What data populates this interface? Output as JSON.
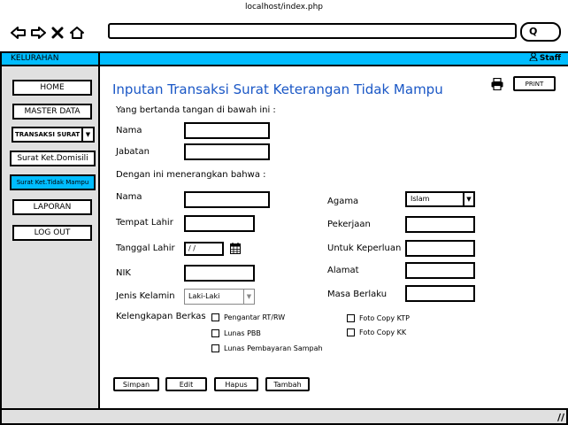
{
  "browser": {
    "address": "localhost/index.php",
    "search_icon_label": "Q"
  },
  "app": {
    "brand": "KELURAHAN",
    "user": "Staff"
  },
  "sidebar": {
    "items": [
      {
        "label": "HOME"
      },
      {
        "label": "MASTER DATA"
      },
      {
        "label": "TRANSAKSI SURAT"
      },
      {
        "label": "Surat Ket.Domisili"
      },
      {
        "label": "Surat Ket.Tidak Mampu",
        "active": true
      },
      {
        "label": "LAPORAN"
      },
      {
        "label": "LOG OUT"
      }
    ]
  },
  "main": {
    "title": "Inputan Transaksi Surat Keterangan Tidak Mampu",
    "print_label": "PRINT",
    "intro": "Yang bertanda tangan di bawah ini :",
    "signer": {
      "name_label": "Nama",
      "position_label": "Jabatan"
    },
    "section2": "Dengan ini menerangkan bahwa :",
    "left_fields": {
      "name_label": "Nama",
      "birthplace_label": "Tempat Lahir",
      "birthdate_label": "Tanggal Lahir",
      "birthdate_placeholder": "/ /",
      "nik_label": "NIK",
      "gender_label": "Jenis Kelamin",
      "gender_value": "Laki-Laki"
    },
    "right_fields": {
      "religion_label": "Agama",
      "religion_value": "Islam",
      "job_label": "Pekerjaan",
      "purpose_label": "Untuk Keperluan",
      "address_label": "Alamat",
      "validity_label": "Masa Berlaku"
    },
    "attachments": {
      "label": "Kelengkapan Berkas",
      "items": [
        "Pengantar RT/RW",
        "Lunas PBB",
        "Lunas Pembayaran Sampah",
        "Foto Copy KTP",
        "Foto Copy KK"
      ]
    },
    "actions": {
      "save": "Simpan",
      "edit": "Edit",
      "delete": "Hapus",
      "add": "Tambah"
    }
  },
  "colors": {
    "accent": "#00bcff",
    "title": "#1a57c6",
    "sidebar_bg": "#e0e0e0"
  }
}
